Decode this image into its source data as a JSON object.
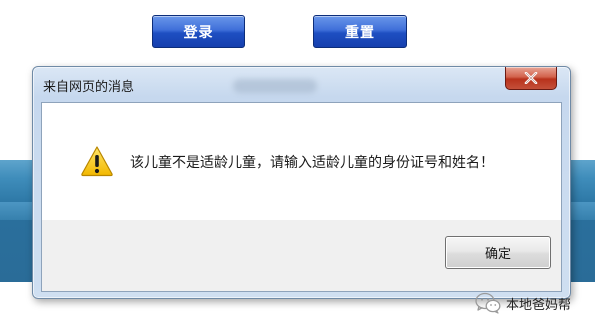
{
  "page": {
    "login_label": "登录",
    "reset_label": "重置"
  },
  "dialog": {
    "title": "来自网页的消息",
    "close_glyph": "x",
    "message": "该儿童不是适龄儿童，请输入适龄儿童的身份证号和姓名！",
    "ok_label": "确定",
    "icon": "warning-icon"
  },
  "watermark": {
    "text": "本地爸妈帮",
    "icon": "wechat-icon"
  },
  "colors": {
    "page_button_blue": "#1e4fc2",
    "close_button_red": "#c4503a",
    "band_blue": "#2f7aa8",
    "warning_yellow": "#f5c400"
  }
}
